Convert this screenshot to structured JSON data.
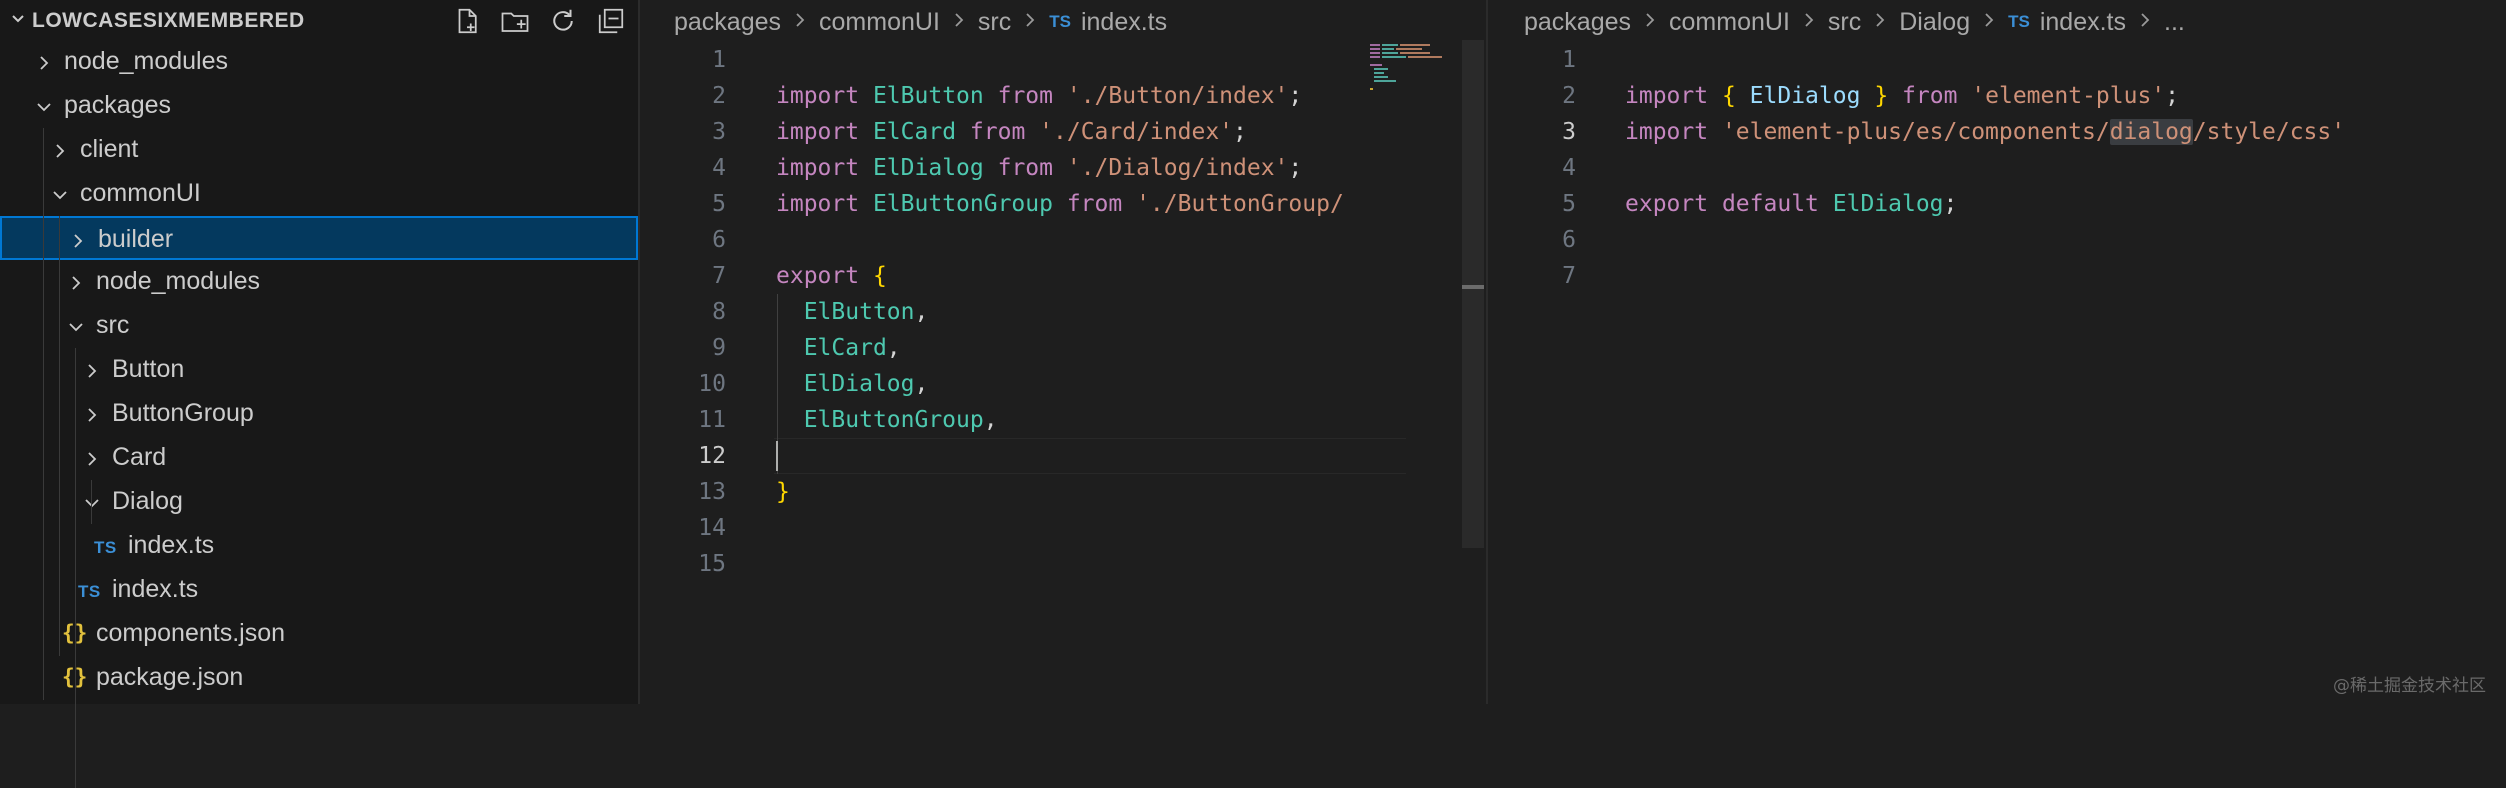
{
  "explorer": {
    "title": "LOWCASESIXMEMBERED",
    "actions": [
      "new-file-icon",
      "new-folder-icon",
      "refresh-icon",
      "collapse-all-icon"
    ],
    "items": [
      {
        "label": "node_modules",
        "type": "folder",
        "expanded": false,
        "depth": 0
      },
      {
        "label": "packages",
        "type": "folder",
        "expanded": true,
        "depth": 0
      },
      {
        "label": "client",
        "type": "folder",
        "expanded": false,
        "depth": 1
      },
      {
        "label": "commonUI",
        "type": "folder",
        "expanded": true,
        "depth": 1
      },
      {
        "label": "builder",
        "type": "folder",
        "expanded": false,
        "depth": 2,
        "selected": true
      },
      {
        "label": "node_modules",
        "type": "folder",
        "expanded": false,
        "depth": 2
      },
      {
        "label": "src",
        "type": "folder",
        "expanded": true,
        "depth": 2
      },
      {
        "label": "Button",
        "type": "folder",
        "expanded": false,
        "depth": 3
      },
      {
        "label": "ButtonGroup",
        "type": "folder",
        "expanded": false,
        "depth": 3
      },
      {
        "label": "Card",
        "type": "folder",
        "expanded": false,
        "depth": 3
      },
      {
        "label": "Dialog",
        "type": "folder",
        "expanded": true,
        "depth": 3
      },
      {
        "label": "index.ts",
        "type": "ts",
        "depth": 4
      },
      {
        "label": "index.ts",
        "type": "ts",
        "depth": 3
      },
      {
        "label": "components.json",
        "type": "json",
        "depth": 2
      },
      {
        "label": "package.json",
        "type": "json",
        "depth": 2
      }
    ],
    "ts_badge": "TS",
    "json_badge": "{}"
  },
  "left_editor": {
    "breadcrumb": [
      "packages",
      "commonUI",
      "src"
    ],
    "file_badge": "TS",
    "file": "index.ts",
    "active_line": 12,
    "lines": [
      [],
      [
        [
          "import",
          "kw"
        ],
        [
          " ",
          ""
        ],
        [
          "ElButton",
          "cls"
        ],
        [
          " ",
          ""
        ],
        [
          "from",
          "kw"
        ],
        [
          " ",
          ""
        ],
        [
          "'./Button/index'",
          "str"
        ],
        [
          ";",
          "punc"
        ]
      ],
      [
        [
          "import",
          "kw"
        ],
        [
          " ",
          ""
        ],
        [
          "ElCard",
          "cls"
        ],
        [
          " ",
          ""
        ],
        [
          "from",
          "kw"
        ],
        [
          " ",
          ""
        ],
        [
          "'./Card/index'",
          "str"
        ],
        [
          ";",
          "punc"
        ]
      ],
      [
        [
          "import",
          "kw"
        ],
        [
          " ",
          ""
        ],
        [
          "ElDialog",
          "cls"
        ],
        [
          " ",
          ""
        ],
        [
          "from",
          "kw"
        ],
        [
          " ",
          ""
        ],
        [
          "'./Dialog/index'",
          "str"
        ],
        [
          ";",
          "punc"
        ]
      ],
      [
        [
          "import",
          "kw"
        ],
        [
          " ",
          ""
        ],
        [
          "ElButtonGroup",
          "cls"
        ],
        [
          " ",
          ""
        ],
        [
          "from",
          "kw"
        ],
        [
          " ",
          ""
        ],
        [
          "'./ButtonGroup/",
          "str"
        ]
      ],
      [],
      [
        [
          "export",
          "kw"
        ],
        [
          " ",
          ""
        ],
        [
          "{",
          "brace"
        ]
      ],
      [
        [
          "  ",
          ""
        ],
        [
          "ElButton",
          "cls"
        ],
        [
          ",",
          "punc"
        ]
      ],
      [
        [
          "  ",
          ""
        ],
        [
          "ElCard",
          "cls"
        ],
        [
          ",",
          "punc"
        ]
      ],
      [
        [
          "  ",
          ""
        ],
        [
          "ElDialog",
          "cls"
        ],
        [
          ",",
          "punc"
        ]
      ],
      [
        [
          "  ",
          ""
        ],
        [
          "ElButtonGroup",
          "cls"
        ],
        [
          ",",
          "punc"
        ]
      ],
      [],
      [
        [
          "}",
          "brace"
        ]
      ],
      [],
      []
    ]
  },
  "right_editor": {
    "breadcrumb": [
      "packages",
      "commonUI",
      "src",
      "Dialog"
    ],
    "file_badge": "TS",
    "file": "index.ts",
    "trailing": "...",
    "active_line": 3,
    "lines": [
      [],
      [
        [
          "import",
          "kw"
        ],
        [
          " ",
          ""
        ],
        [
          "{",
          "brace"
        ],
        [
          " ",
          ""
        ],
        [
          "ElDialog",
          "var"
        ],
        [
          " ",
          ""
        ],
        [
          "}",
          "brace"
        ],
        [
          " ",
          ""
        ],
        [
          "from",
          "kw"
        ],
        [
          " ",
          ""
        ],
        [
          "'element-plus'",
          "str"
        ],
        [
          ";",
          "punc"
        ]
      ],
      [
        [
          "import",
          "kw"
        ],
        [
          " ",
          ""
        ],
        [
          "'element-plus/es/components/",
          "str"
        ],
        [
          "dialog",
          "str hl"
        ],
        [
          "/style/css'",
          "str"
        ]
      ],
      [],
      [
        [
          "export",
          "kw"
        ],
        [
          " ",
          ""
        ],
        [
          "default",
          "kw"
        ],
        [
          " ",
          ""
        ],
        [
          "ElDialog",
          "cls"
        ],
        [
          ";",
          "punc"
        ]
      ],
      [],
      []
    ]
  },
  "watermark": "@稀土掘金技术社区"
}
